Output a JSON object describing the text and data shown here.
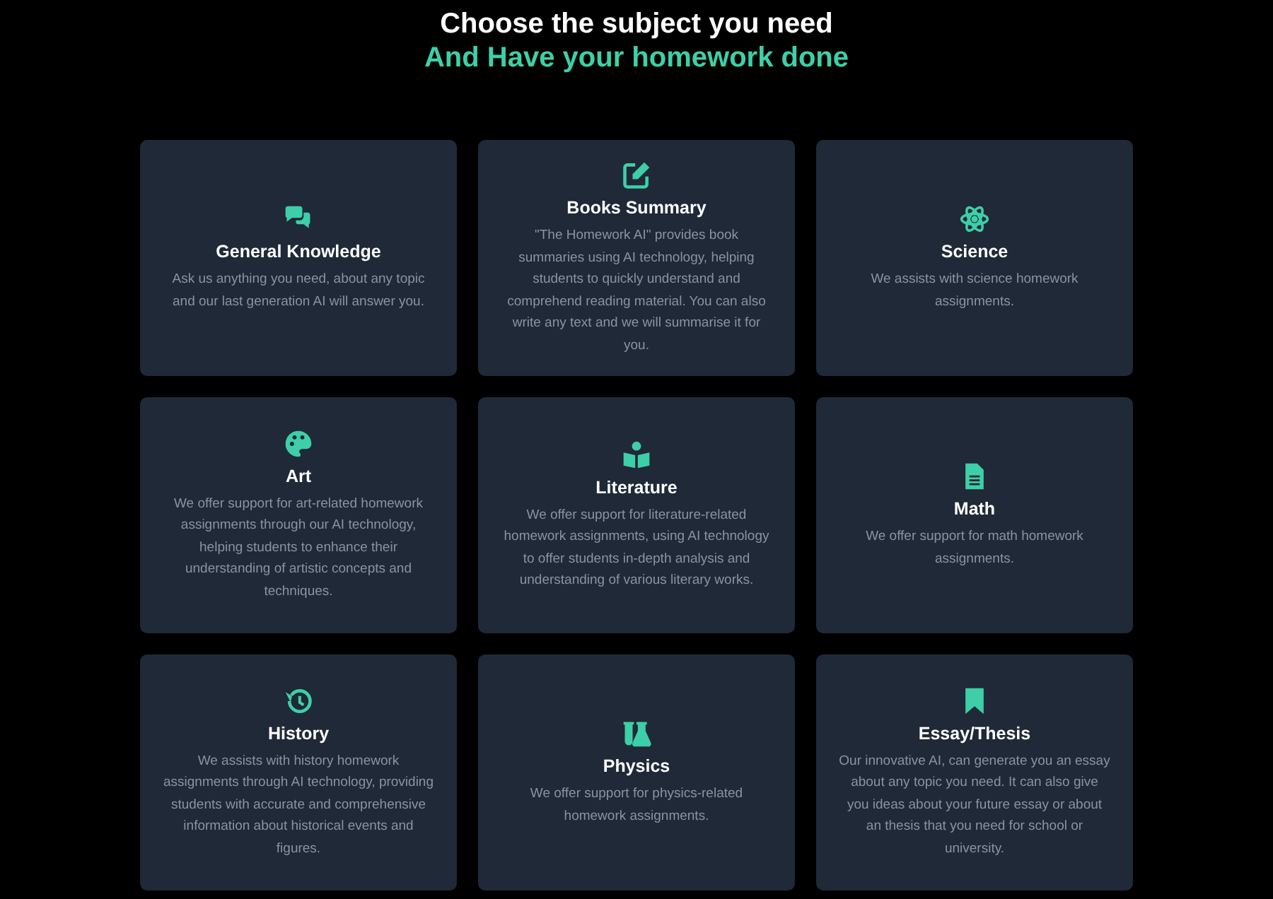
{
  "heading": {
    "title": "Choose the subject you need",
    "subtitle": "And Have your homework done"
  },
  "cards": [
    {
      "kind": "chat",
      "title": "General Knowledge",
      "text": "Ask us anything you need, about any topic and our last generation AI will answer you."
    },
    {
      "kind": "edit",
      "title": "Books Summary",
      "text": "\"The Homework AI\" provides book summaries using AI technology, helping students to quickly understand and comprehend reading material. You can also write any text and we will summarise it for you."
    },
    {
      "kind": "atom",
      "title": "Science",
      "text": "We assists with science homework assignments."
    },
    {
      "kind": "palette",
      "title": "Art",
      "text": "We offer support for art-related homework assignments through our AI technology, helping students to enhance their understanding of artistic concepts and techniques."
    },
    {
      "kind": "reader",
      "title": "Literature",
      "text": "We offer support for literature-related homework assignments, using AI technology to offer students in-depth analysis and understanding of various literary works."
    },
    {
      "kind": "document",
      "title": "Math",
      "text": "We offer support for math homework assignments."
    },
    {
      "kind": "history",
      "title": "History",
      "text": "We assists with history homework assignments through AI technology, providing students with accurate and comprehensive information about historical events and figures."
    },
    {
      "kind": "flask",
      "title": "Physics",
      "text": "We offer support for physics-related homework assignments."
    },
    {
      "kind": "bookmark",
      "title": "Essay/Thesis",
      "text": "Our innovative AI, can generate you an essay about any topic you need. It can also give you ideas about your future essay or about an thesis that you need for school or university."
    }
  ]
}
